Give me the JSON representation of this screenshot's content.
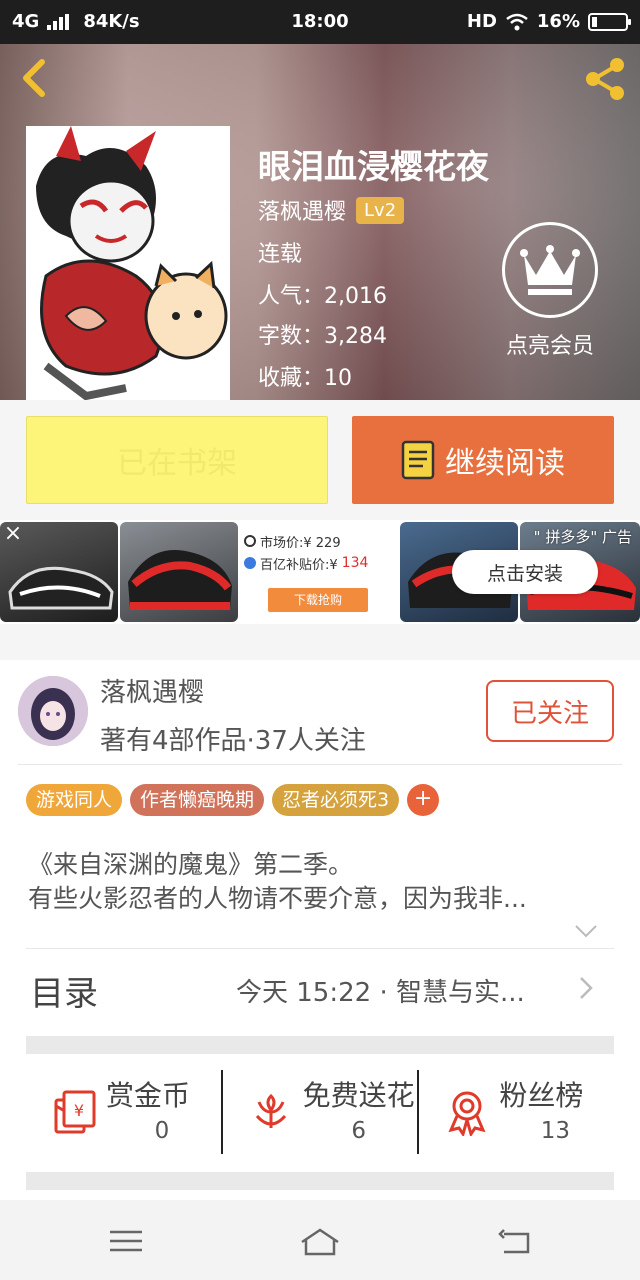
{
  "status_bar": {
    "network": "4G",
    "speed": "84K/s",
    "time": "18:00",
    "hd": "HD",
    "battery": "16%",
    "battery_level": 0.16
  },
  "header": {
    "back_icon": "chevron-left-icon",
    "share_icon": "share-icon",
    "title": "眼泪血浸樱花夜",
    "author": "落枫遇樱",
    "level": "Lv2",
    "status": "连载",
    "popularity": "人气：2,016",
    "word_count": "字数：3,284",
    "favorites": "收藏：10",
    "vip_label": "点亮会员"
  },
  "actions": {
    "shelf_label": "已在书架",
    "read_label": "继续阅读"
  },
  "ad": {
    "market_price": "市场价:¥ 229",
    "subsidy_label": "百亿补贴价:¥",
    "subsidy_price": "134",
    "download_label": "下载抢购",
    "tag": "\" 拼多多\" 广告",
    "install_label": "点击安装",
    "close": "×"
  },
  "author_card": {
    "name": "落枫遇樱",
    "stats": "著有4部作品·37人关注",
    "follow_label": "已关注",
    "tags": [
      {
        "label": "游戏同人",
        "color": "#f0a73a"
      },
      {
        "label": "作者懒癌晚期",
        "color": "#d0735a"
      },
      {
        "label": "忍者必须死3",
        "color": "#d6a23e"
      }
    ],
    "tag_add": "+",
    "intro_lines": [
      "《来自深渊的魔鬼》第二季。",
      "有些火影忍者的人物请不要介意，因为我非..."
    ],
    "toc_label": "目录",
    "toc_latest": "今天 15:22 · 智慧与实...",
    "stats_row": [
      {
        "label": "赏金币",
        "value": "0",
        "icon": "red-envelope-icon"
      },
      {
        "label": "免费送花",
        "value": "6",
        "icon": "flower-icon"
      },
      {
        "label": "粉丝榜",
        "value": "13",
        "icon": "medal-icon"
      }
    ]
  },
  "colors": {
    "accent_orange": "#e8703f",
    "shelf_yellow": "#fdf57a",
    "follow_red": "#e0523a",
    "vip_gold": "#e8b44a"
  }
}
